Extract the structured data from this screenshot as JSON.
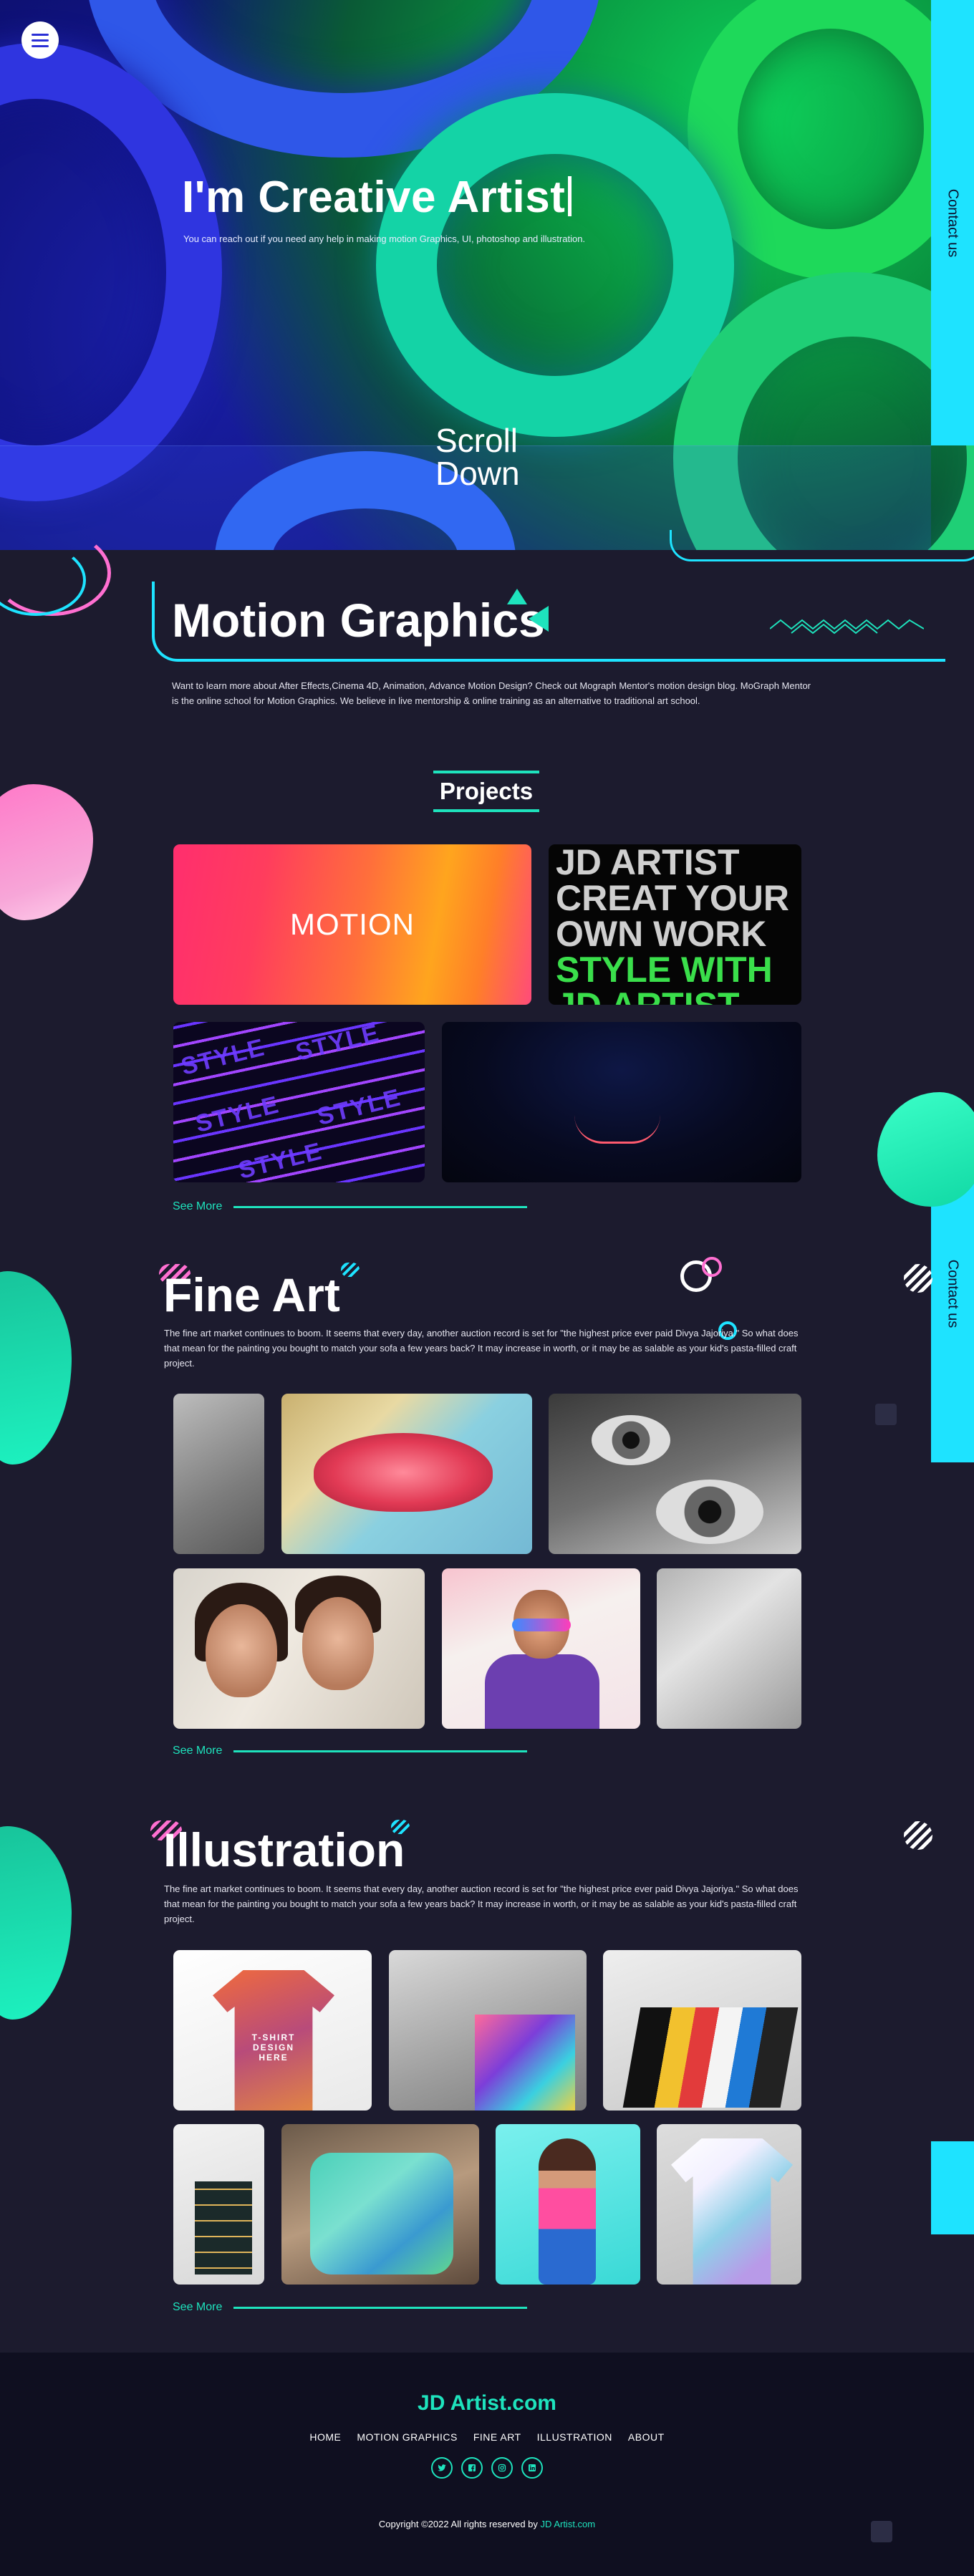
{
  "hero": {
    "title": "I'm Creative Artist",
    "subtitle": "You can reach out if you need any help in making motion Graphics, UI, photoshop and illustration.",
    "scroll_line1": "Scroll",
    "scroll_line2": "Down",
    "menu_icon": "hamburger-icon"
  },
  "contact_tab": {
    "label": "Contact us"
  },
  "motion": {
    "title": "Motion Graphics",
    "description": "Want to learn more about After Effects,Cinema 4D, Animation, Advance Motion Design? Check out Mograph Mentor's motion design blog. MoGraph Mentor is the online school for Motion Graphics. We believe in live mentorship & online training as an alternative to traditional art school.",
    "projects_label": "Projects",
    "card_motion_label": "MOTION",
    "card_text_lines": [
      "JD ARTIST",
      "CREAT YOUR",
      "OWN WORK",
      "STYLE WITH",
      "JD ARTIST"
    ],
    "card_style_word": "STYLE",
    "see_more": "See More"
  },
  "fineart": {
    "title": "Fine Art",
    "description": "The fine art market continues to boom. It seems that every day, another auction record is set for \"the highest price ever paid Divya Jajoriya.\" So what does that mean for the painting you bought to match your sofa a few years back? It may increase in worth, or it may be as salable as your kid's pasta-filled craft project.",
    "see_more": "See More"
  },
  "illustration": {
    "title": "Illustration",
    "description": "The fine art market continues to boom. It seems that every day, another auction record is set for \"the highest price ever paid Divya Jajoriya.\" So what does that mean for the painting you bought to match your sofa a few years back? It may increase in worth, or it may be as salable as your kid's pasta-filled craft project.",
    "tee_text": "T-SHIRT DESIGN HERE",
    "see_more": "See More"
  },
  "footer": {
    "brand": "JD Artist.com",
    "nav": [
      "HOME",
      "MOTION GRAPHICS",
      "FINE ART",
      "ILLUSTRATION",
      "ABOUT"
    ],
    "social_icons": [
      "twitter-icon",
      "facebook-icon",
      "instagram-icon",
      "linkedin-icon"
    ],
    "copyright": "Copyright ©2022 All rights reserved by",
    "copyright_brand": "JD Artist.com"
  },
  "colors": {
    "accent": "#1ee3bd",
    "contact_tab": "#1ee3ff",
    "background": "#1c1b2e",
    "footer_bg": "#0f0f20"
  }
}
